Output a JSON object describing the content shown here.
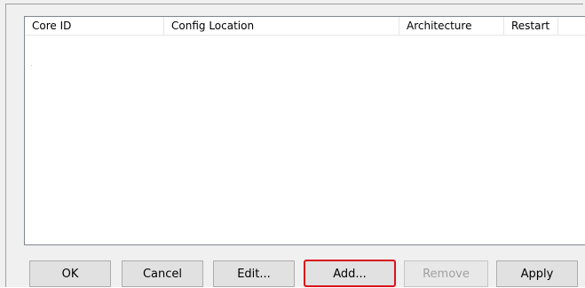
{
  "list": {
    "columns": [
      "Core ID",
      "Config Location",
      "Architecture",
      "Restart",
      ""
    ],
    "rows": []
  },
  "buttons": {
    "ok": "OK",
    "cancel": "Cancel",
    "edit": "Edit...",
    "add": "Add...",
    "remove": "Remove",
    "apply": "Apply"
  },
  "states": {
    "remove_enabled": false,
    "add_highlighted": true,
    "highlight_color": "#d9121b"
  }
}
